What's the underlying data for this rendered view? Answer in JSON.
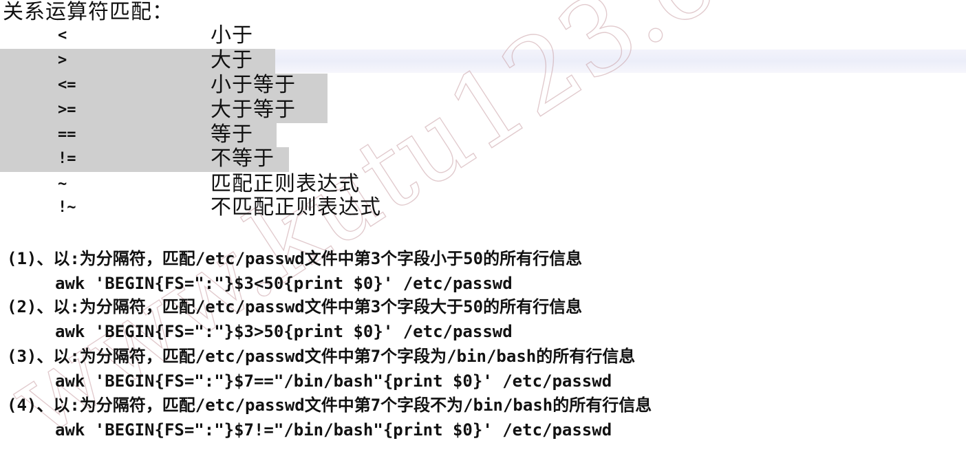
{
  "title": "关系运算符匹配：",
  "operators": [
    {
      "op": "<",
      "desc": "小于"
    },
    {
      "op": ">",
      "desc": "大于"
    },
    {
      "op": "<=",
      "desc": "小于等于"
    },
    {
      "op": ">=",
      "desc": "大于等于"
    },
    {
      "op": "==",
      "desc": "等于"
    },
    {
      "op": "!=",
      "desc": "不等于"
    },
    {
      "op": "~",
      "desc": "匹配正则表达式"
    },
    {
      "op": "!~",
      "desc": "不匹配正则表达式"
    }
  ],
  "examples": [
    {
      "desc": "(1)、以:为分隔符，匹配/etc/passwd文件中第3个字段小于50的所有行信息",
      "cmd": "awk 'BEGIN{FS=\":\"}$3<50{print $0}' /etc/passwd"
    },
    {
      "desc": "(2)、以:为分隔符，匹配/etc/passwd文件中第3个字段大于50的所有行信息",
      "cmd": "awk 'BEGIN{FS=\":\"}$3>50{print $0}' /etc/passwd"
    },
    {
      "desc": "(3)、以:为分隔符，匹配/etc/passwd文件中第7个字段为/bin/bash的所有行信息",
      "cmd": "awk 'BEGIN{FS=\":\"}$7==\"/bin/bash\"{print $0}' /etc/passwd"
    },
    {
      "desc": "(4)、以:为分隔符，匹配/etc/passwd文件中第7个字段不为/bin/bash的所有行信息",
      "cmd": "awk 'BEGIN{FS=\":\"}$7!=\"/bin/bash\"{print $0}' /etc/passwd"
    }
  ],
  "watermark": "www.kutu123.com",
  "colors": {
    "highlight": "#cfcfcf",
    "band": "#eceef9",
    "watermark": "#c9a0a6"
  }
}
